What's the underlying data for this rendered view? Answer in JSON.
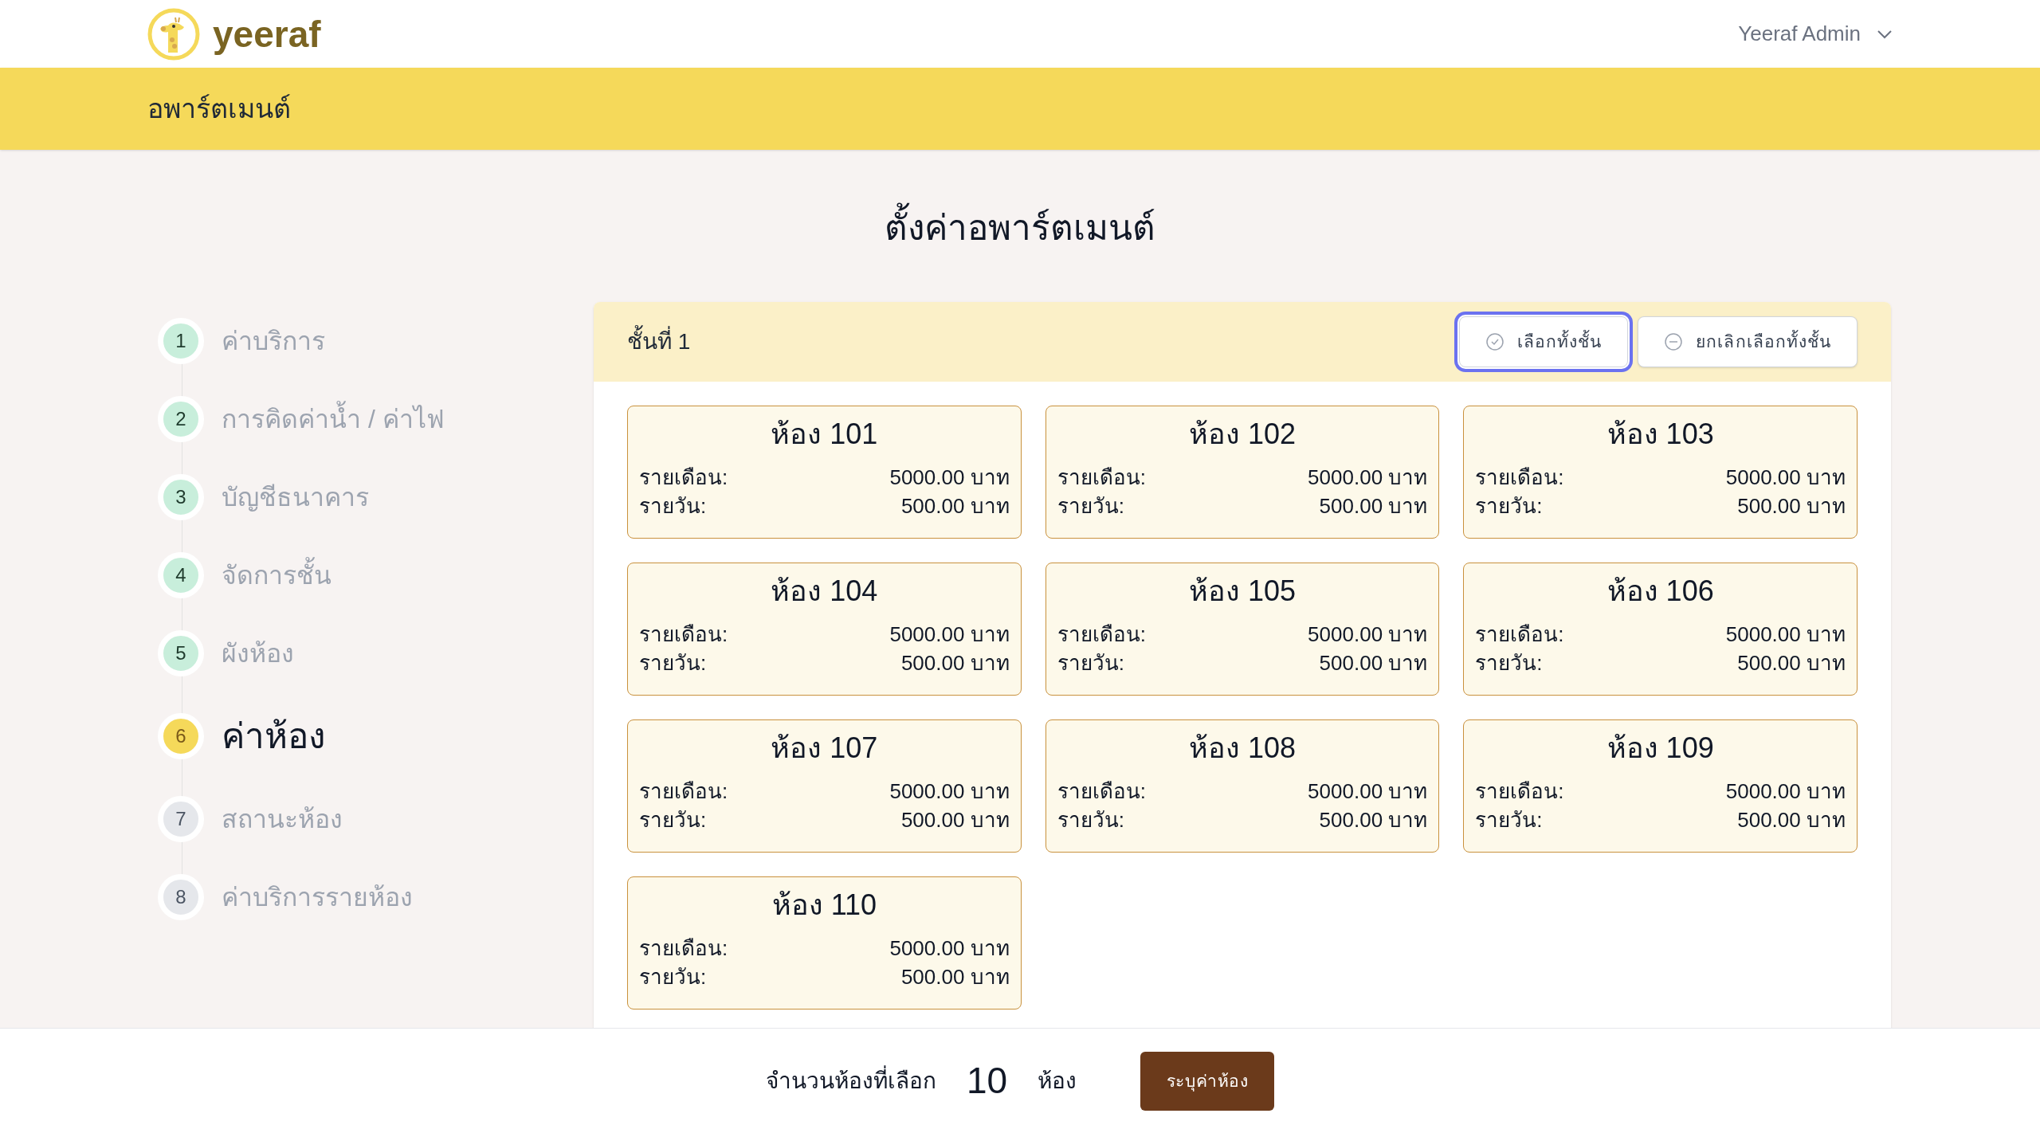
{
  "brand": {
    "name": "yeeraf"
  },
  "user_menu": {
    "label": "Yeeraf Admin"
  },
  "section_title": "อพาร์ตเมนต์",
  "page_title": "ตั้งค่าอพาร์ตเมนต์",
  "steps": [
    {
      "number": "1",
      "label": "ค่าบริการ",
      "completed": true,
      "selected": false
    },
    {
      "number": "2",
      "label": "การคิดค่าน้ำ / ค่าไฟ",
      "completed": true,
      "selected": false
    },
    {
      "number": "3",
      "label": "บัญชีธนาคาร",
      "completed": true,
      "selected": false
    },
    {
      "number": "4",
      "label": "จัดการชั้น",
      "completed": true,
      "selected": false
    },
    {
      "number": "5",
      "label": "ผังห้อง",
      "completed": true,
      "selected": false
    },
    {
      "number": "6",
      "label": "ค่าห้อง",
      "completed": false,
      "selected": true
    },
    {
      "number": "7",
      "label": "สถานะห้อง",
      "completed": false,
      "selected": false
    },
    {
      "number": "8",
      "label": "ค่าบริการรายห้อง",
      "completed": false,
      "selected": false
    }
  ],
  "floor": {
    "title": "ชั้นที่ 1",
    "buttons": [
      {
        "label": "เลือกทั้งชั้น",
        "kind": "select",
        "focused": true
      },
      {
        "label": "ยกเลิกเลือกทั้งชั้น",
        "kind": "deselect",
        "focused": false
      }
    ],
    "rooms": [
      {
        "name": "ห้อง 101",
        "monthly_label": "รายเดือน:",
        "monthly": "5000.00 บาท",
        "daily_label": "รายวัน:",
        "daily": "500.00 บาท"
      },
      {
        "name": "ห้อง 102",
        "monthly_label": "รายเดือน:",
        "monthly": "5000.00 บาท",
        "daily_label": "รายวัน:",
        "daily": "500.00 บาท"
      },
      {
        "name": "ห้อง 103",
        "monthly_label": "รายเดือน:",
        "monthly": "5000.00 บาท",
        "daily_label": "รายวัน:",
        "daily": "500.00 บาท"
      },
      {
        "name": "ห้อง 104",
        "monthly_label": "รายเดือน:",
        "monthly": "5000.00 บาท",
        "daily_label": "รายวัน:",
        "daily": "500.00 บาท"
      },
      {
        "name": "ห้อง 105",
        "monthly_label": "รายเดือน:",
        "monthly": "5000.00 บาท",
        "daily_label": "รายวัน:",
        "daily": "500.00 บาท"
      },
      {
        "name": "ห้อง 106",
        "monthly_label": "รายเดือน:",
        "monthly": "5000.00 บาท",
        "daily_label": "รายวัน:",
        "daily": "500.00 บาท"
      },
      {
        "name": "ห้อง 107",
        "monthly_label": "รายเดือน:",
        "monthly": "5000.00 บาท",
        "daily_label": "รายวัน:",
        "daily": "500.00 บาท"
      },
      {
        "name": "ห้อง 108",
        "monthly_label": "รายเดือน:",
        "monthly": "5000.00 บาท",
        "daily_label": "รายวัน:",
        "daily": "500.00 บาท"
      },
      {
        "name": "ห้อง 109",
        "monthly_label": "รายเดือน:",
        "monthly": "5000.00 บาท",
        "daily_label": "รายวัน:",
        "daily": "500.00 บาท"
      },
      {
        "name": "ห้อง 110",
        "monthly_label": "รายเดือน:",
        "monthly": "5000.00 บาท",
        "daily_label": "รายวัน:",
        "daily": "500.00 บาท"
      }
    ]
  },
  "footer": {
    "count_label": "จำนวนห้องที่เลือก",
    "count": "10",
    "unit": "ห้อง",
    "action": "ระบุค่าห้อง"
  }
}
